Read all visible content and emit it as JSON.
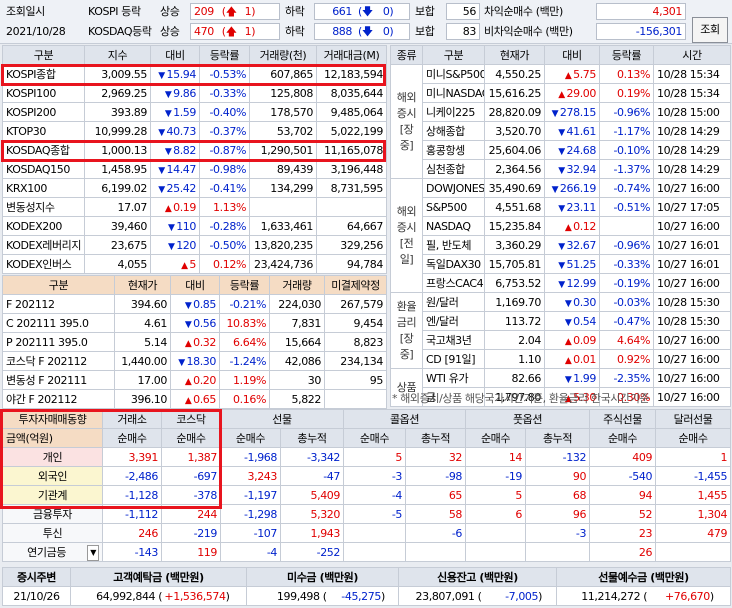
{
  "topbar": {
    "label1": "조회일시",
    "date": "2021/10/28",
    "r1": {
      "name": "KOSPI 등락",
      "t1": "상승",
      "n1": "209",
      "u1": "1",
      "t2": "하락",
      "n2": "661",
      "d2": "0",
      "t3": "보합",
      "n3": "56",
      "t4": "차익순매수 (백만)",
      "v4": "4,301"
    },
    "r2": {
      "name": "KOSDAQ등락",
      "t1": "상승",
      "n1": "470",
      "u1": "1",
      "t2": "하락",
      "n2": "888",
      "d2": "0",
      "t3": "보합",
      "n3": "83",
      "t4": "비차익순매수 (백만)",
      "v4": "-156,301"
    },
    "query_btn": "조회"
  },
  "index": {
    "headers": [
      "구분",
      "지수",
      "대비",
      "등락률",
      "거래량(천)",
      "거래대금(M)"
    ],
    "rows": [
      {
        "name": "KOSPI종합",
        "v": "3,009.55",
        "dir": "dn",
        "chg": "15.94",
        "pct": "-0.53%",
        "vol": "607,865",
        "amt": "12,183,594"
      },
      {
        "name": "KOSPI100",
        "v": "2,969.25",
        "dir": "dn",
        "chg": "9.86",
        "pct": "-0.33%",
        "vol": "125,808",
        "amt": "8,035,644"
      },
      {
        "name": "KOSPI200",
        "v": "393.89",
        "dir": "dn",
        "chg": "1.59",
        "pct": "-0.40%",
        "vol": "178,570",
        "amt": "9,485,064"
      },
      {
        "name": "KTOP30",
        "v": "10,999.28",
        "dir": "dn",
        "chg": "40.73",
        "pct": "-0.37%",
        "vol": "53,702",
        "amt": "5,022,199"
      },
      {
        "name": "KOSDAQ종합",
        "v": "1,000.13",
        "dir": "dn",
        "chg": "8.82",
        "pct": "-0.87%",
        "vol": "1,290,501",
        "amt": "11,165,078"
      },
      {
        "name": "KOSDAQ150",
        "v": "1,458.95",
        "dir": "dn",
        "chg": "14.47",
        "pct": "-0.98%",
        "vol": "89,439",
        "amt": "3,196,448"
      },
      {
        "name": "KRX100",
        "v": "6,199.02",
        "dir": "dn",
        "chg": "25.42",
        "pct": "-0.41%",
        "vol": "134,299",
        "amt": "8,731,595"
      },
      {
        "name": "변동성지수",
        "v": "17.07",
        "dir": "up",
        "chg": "0.19",
        "pct": "1.13%",
        "vol": "",
        "amt": ""
      },
      {
        "name": "KODEX200",
        "v": "39,460",
        "dir": "dn",
        "chg": "110",
        "pct": "-0.28%",
        "vol": "1,633,461",
        "amt": "64,667"
      },
      {
        "name": "KODEX레버리지",
        "v": "23,675",
        "dir": "dn",
        "chg": "120",
        "pct": "-0.50%",
        "vol": "13,820,235",
        "amt": "329,256"
      },
      {
        "name": "KODEX인버스",
        "v": "4,055",
        "dir": "up",
        "chg": "5",
        "pct": "0.12%",
        "vol": "23,424,736",
        "amt": "94,784"
      }
    ]
  },
  "fut": {
    "headers": [
      "구분",
      "현재가",
      "대비",
      "등락률",
      "거래량",
      "미결제약정"
    ],
    "rows": [
      {
        "name": "F 202112",
        "v": "394.60",
        "dir": "dn",
        "chg": "0.85",
        "pct": "-0.21%",
        "vol": "224,030",
        "oi": "267,579"
      },
      {
        "name": "C 202111 395.0",
        "v": "4.61",
        "dir": "dn",
        "chg": "0.56",
        "pct": "10.83%",
        "vol": "7,831",
        "oi": "9,454"
      },
      {
        "name": "P 202111 395.0",
        "v": "5.14",
        "dir": "up",
        "chg": "0.32",
        "pct": "6.64%",
        "vol": "15,664",
        "oi": "8,823"
      },
      {
        "name": "코스닥 F 202112",
        "v": "1,440.00",
        "dir": "dn",
        "chg": "18.30",
        "pct": "-1.24%",
        "vol": "42,086",
        "oi": "234,134"
      },
      {
        "name": "변동성 F 202111",
        "v": "17.00",
        "dir": "up",
        "chg": "0.20",
        "pct": "1.19%",
        "vol": "30",
        "oi": "95"
      },
      {
        "name": "야간 F 202112",
        "v": "396.10",
        "dir": "up",
        "chg": "0.65",
        "pct": "0.16%",
        "vol": "5,822",
        "oi": ""
      }
    ]
  },
  "world": {
    "headers": [
      "종류",
      "구분",
      "현재가",
      "대비",
      "등락률",
      "시간"
    ],
    "groups": [
      {
        "label": "해외\n증시\n[장중]",
        "rows": [
          {
            "name": "미니S&P500",
            "v": "4,550.25",
            "dir": "up",
            "chg": "5.75",
            "pct": "0.13%",
            "t": "10/28 15:34"
          },
          {
            "name": "미니NASDAQ",
            "v": "15,616.25",
            "dir": "up",
            "chg": "29.00",
            "pct": "0.19%",
            "t": "10/28 15:34"
          },
          {
            "name": "니케이225",
            "v": "28,820.09",
            "dir": "dn",
            "chg": "278.15",
            "pct": "-0.96%",
            "t": "10/28 15:00"
          },
          {
            "name": "상해종합",
            "v": "3,520.70",
            "dir": "dn",
            "chg": "41.61",
            "pct": "-1.17%",
            "t": "10/28 14:29"
          },
          {
            "name": "홍콩항셍",
            "v": "25,604.06",
            "dir": "dn",
            "chg": "24.68",
            "pct": "-0.10%",
            "t": "10/28 14:29"
          },
          {
            "name": "심천종합",
            "v": "2,364.56",
            "dir": "dn",
            "chg": "32.94",
            "pct": "-1.37%",
            "t": "10/28 14:29"
          }
        ]
      },
      {
        "label": "해외\n증시\n[전일]",
        "rows": [
          {
            "name": "DOWJONES",
            "v": "35,490.69",
            "dir": "dn",
            "chg": "266.19",
            "pct": "-0.74%",
            "t": "10/27 16:00"
          },
          {
            "name": "S&P500",
            "v": "4,551.68",
            "dir": "dn",
            "chg": "23.11",
            "pct": "-0.51%",
            "t": "10/27 17:05"
          },
          {
            "name": "NASDAQ",
            "v": "15,235.84",
            "dir": "up",
            "chg": "0.12",
            "pct": "",
            "t": "10/27 16:00"
          },
          {
            "name": "필, 반도체",
            "v": "3,360.29",
            "dir": "dn",
            "chg": "32.67",
            "pct": "-0.96%",
            "t": "10/27 16:01"
          },
          {
            "name": "독일DAX30",
            "v": "15,705.81",
            "dir": "dn",
            "chg": "51.25",
            "pct": "-0.33%",
            "t": "10/27 16:01"
          },
          {
            "name": "프랑스CAC40",
            "v": "6,753.52",
            "dir": "dn",
            "chg": "12.99",
            "pct": "-0.19%",
            "t": "10/27 16:00"
          }
        ]
      },
      {
        "label": "환율\n금리\n[장중]",
        "rows": [
          {
            "name": "원/달러",
            "v": "1,169.70",
            "dir": "dn",
            "chg": "0.30",
            "pct": "-0.03%",
            "t": "10/28 15:30"
          },
          {
            "name": "엔/달러",
            "v": "113.72",
            "dir": "dn",
            "chg": "0.54",
            "pct": "-0.47%",
            "t": "10/28 15:30"
          },
          {
            "name": "국고채3년",
            "v": "2.04",
            "dir": "up",
            "chg": "0.09",
            "pct": "4.64%",
            "t": "10/27 16:00"
          },
          {
            "name": "CD [91일]",
            "v": "1.10",
            "dir": "up",
            "chg": "0.01",
            "pct": "0.92%",
            "t": "10/27 16:00"
          }
        ]
      },
      {
        "label": "상품",
        "rows": [
          {
            "name": "WTI 유가",
            "v": "82.66",
            "dir": "dn",
            "chg": "1.99",
            "pct": "-2.35%",
            "t": "10/27 16:00"
          },
          {
            "name": "금",
            "v": "1,797.80",
            "dir": "up",
            "chg": "5.30",
            "pct": "0.30%",
            "t": "10/27 16:00"
          }
        ]
      }
    ],
    "note": "* 해외증시/상품 해당국가시간기준, 환율금리 한국시간기준"
  },
  "inv": {
    "h1": [
      "투자자매매동향",
      "거래소",
      "코스닥",
      "선물",
      "콜옵션",
      "풋옵션",
      "주식선물",
      "달러선물"
    ],
    "h2": [
      "금액(억원)",
      "순매수",
      "순매수",
      "순매수",
      "총누적",
      "순매수",
      "총누적",
      "순매수",
      "총누적",
      "순매수",
      "순매수"
    ],
    "rows": [
      {
        "name": "개인",
        "c": [
          "3,391",
          "1,387",
          "-1,968",
          "-3,342",
          "5",
          "32",
          "14",
          "-132",
          "409",
          "1"
        ]
      },
      {
        "name": "외국인",
        "c": [
          "-2,486",
          "-697",
          "3,243",
          "-47",
          "-3",
          "-98",
          "-19",
          "90",
          "-540",
          "-1,455"
        ]
      },
      {
        "name": "기관계",
        "c": [
          "-1,128",
          "-378",
          "-1,197",
          "5,409",
          "-4",
          "65",
          "5",
          "68",
          "94",
          "1,455"
        ]
      },
      {
        "name": "금융투자",
        "c": [
          "-1,112",
          "244",
          "-1,298",
          "5,320",
          "-5",
          "58",
          "6",
          "96",
          "52",
          "1,304"
        ]
      },
      {
        "name": "투신",
        "c": [
          "246",
          "-219",
          "-107",
          "1,943",
          "",
          "-6",
          "",
          "-3",
          "23",
          "479"
        ]
      },
      {
        "name": "연기금등",
        "c": [
          "-143",
          "119",
          "-4",
          "-252",
          "",
          "",
          "",
          "",
          "26",
          ""
        ]
      }
    ]
  },
  "bottom": {
    "date_label": "증시주변",
    "date": "21/10/26",
    "items": [
      {
        "label": "고객예탁금 (백만원)",
        "v": "64,992,844",
        "chg": "+1,536,574"
      },
      {
        "label": "미수금 (백만원)",
        "v": "199,498",
        "chg": "-45,275"
      },
      {
        "label": "신용잔고 (백만원)",
        "v": "23,807,091",
        "chg": "-7,005"
      },
      {
        "label": "선물예수금 (백만원)",
        "v": "11,214,272",
        "chg": "+76,670"
      }
    ]
  },
  "colors": {
    "up": "#e00000",
    "down": "#0022cc",
    "highlight": "#e8141e"
  },
  "icons": {
    "up": "arrow-up-icon",
    "down": "arrow-down-icon",
    "dropdown": "dropdown-icon"
  }
}
